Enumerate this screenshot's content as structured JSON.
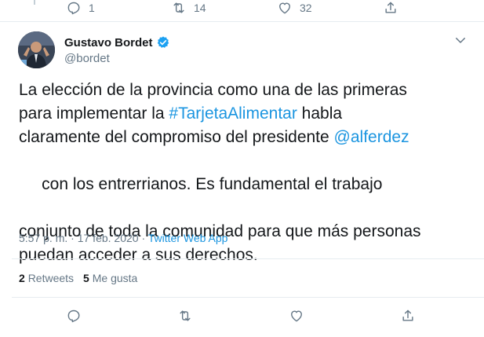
{
  "previous_tweet": {
    "replies": "1",
    "retweets": "14",
    "likes": "32"
  },
  "tweet": {
    "author": {
      "name": "Gustavo Bordet",
      "handle": "@bordet",
      "verified": true
    },
    "text_lines": [
      {
        "parts": [
          "La elección de la provincia como una de las primeras"
        ]
      },
      {
        "parts": [
          "para implementar la ",
          "#TarjetaAlimentar",
          " habla"
        ]
      },
      {
        "parts": [
          "claramente del compromiso del presidente ",
          "@alferdez"
        ]
      },
      {
        "parts": [
          " con los entrerrianos. Es fundamental el trabajo"
        ]
      },
      {
        "parts": [
          "conjunto de toda la comunidad para que más personas"
        ]
      },
      {
        "parts": [
          "puedan acceder a sus derechos."
        ]
      }
    ],
    "time": "5:57 p. m.",
    "separator": "·",
    "date": "17 feb. 2020",
    "source": "Twitter Web App",
    "stats": {
      "retweets_count": "2",
      "retweets_label": "Retweets",
      "likes_count": "5",
      "likes_label": "Me gusta"
    }
  },
  "colors": {
    "link": "#1b95e0",
    "secondary_text": "#657786",
    "primary_text": "#14171a",
    "divider": "#e6ecf0",
    "verified": "#1da1f2"
  }
}
